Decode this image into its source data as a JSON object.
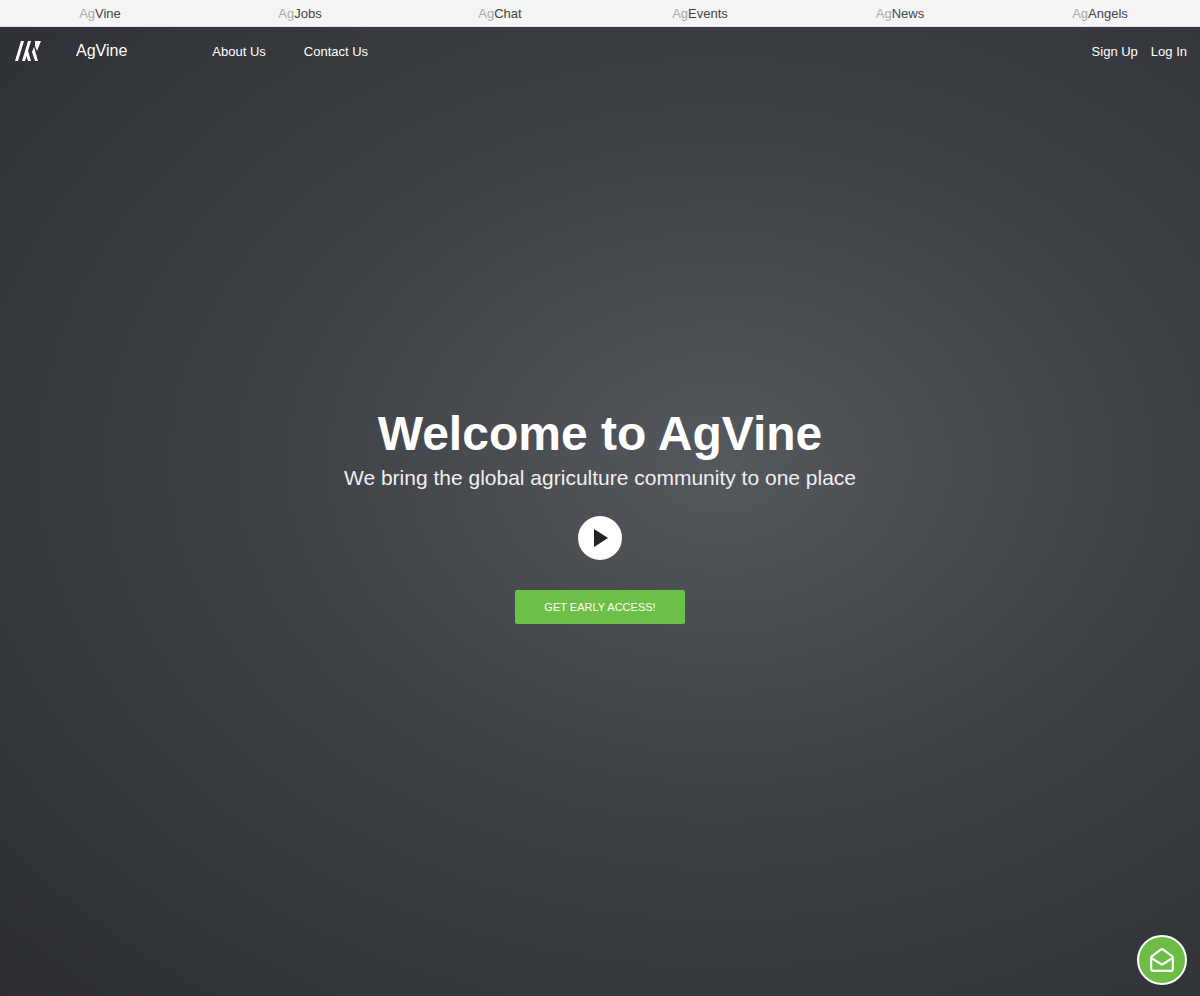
{
  "top_bar": {
    "items": [
      {
        "prefix": "Ag",
        "name": "Vine"
      },
      {
        "prefix": "Ag",
        "name": "Jobs"
      },
      {
        "prefix": "Ag",
        "name": "Chat"
      },
      {
        "prefix": "Ag",
        "name": "Events"
      },
      {
        "prefix": "Ag",
        "name": "News"
      },
      {
        "prefix": "Ag",
        "name": "Angels"
      }
    ]
  },
  "nav": {
    "brand": "AgVine",
    "links": [
      "About Us",
      "Contact Us"
    ],
    "actions": [
      "Sign Up",
      "Log In"
    ]
  },
  "hero": {
    "title": "Welcome to AgVine",
    "subtitle": "We bring the global agriculture community to one place",
    "cta": "GET EARLY ACCESS!"
  }
}
